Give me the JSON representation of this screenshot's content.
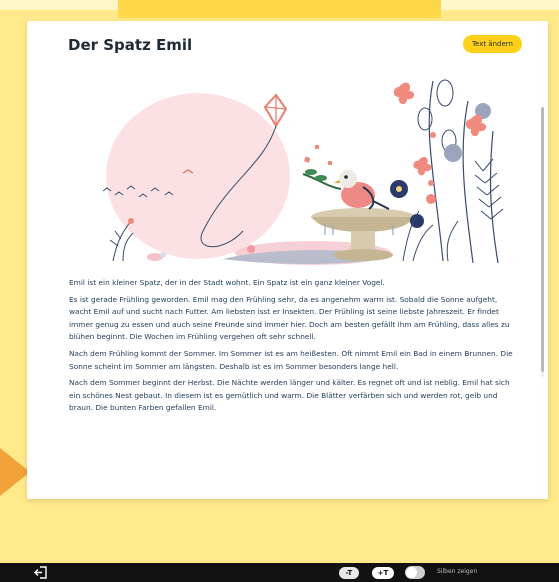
{
  "colors": {
    "accent": "#ffcf19",
    "highlight": "#e33a4a",
    "text": "#1f3a5a",
    "background": "#ffe98a"
  },
  "title": "Der Spatz Emil",
  "change_text_button": "Text ändern",
  "illustration": {
    "name": "sparrow-birdbath-garden-illustration"
  },
  "paragraphs": [
    "Emil ist ein kleiner Spatz, der in der Stadt wohnt. Ein Spatz ist ein ganz kleiner Vogel.",
    "Es ist gerade Frühling geworden. Emil mag den Frühling sehr, da es angenehm warm ist. Sobald die Sonne aufgeht, wacht Emil auf und sucht nach Futter. Am liebsten isst er Insekten. Der Frühling ist seine liebste Jahreszeit. Er findet immer genug zu essen und auch seine Freunde sind immer hier. Doch am besten gefällt ihm am Frühling, dass alles zu blühen beginnt. Die Wochen im Frühling vergehen oft sehr schnell.",
    "Nach dem Frühling kommt der Sommer. Im Sommer ist es am heißesten. Oft nimmt Emil ein Bad in einem Brunnen. Die Sonne scheint im Sommer am längsten. Deshalb ist es im Sommer besonders lange hell.",
    "Nach dem Sommer beginnt der Herbst. Die Nächte werden länger und kälter. Es regnet oft und ist neblig. Emil hat sich ein schönes Nest gebaut. In diesem ist es gemütlich und warm. Die Blätter verfärben sich und werden rot, gelb und braun. Die bunten Farben gefallen Emil."
  ],
  "bottom_bar": {
    "exit_icon": "exit-icon",
    "font_smaller": "-T",
    "font_larger": "+T",
    "toggle_label": "Silben zeigen",
    "toggle_on": false
  }
}
